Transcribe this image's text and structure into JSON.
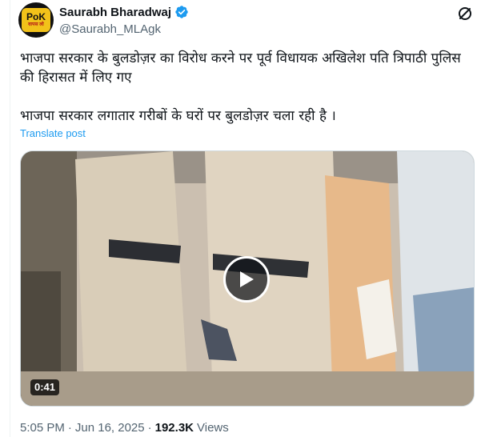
{
  "author": {
    "display_name": "Saurabh Bharadwaj",
    "handle": "@Saurabh_MLAgk",
    "verified": true,
    "avatar_text_main": "PoK",
    "avatar_text_sub": "वापस लो",
    "verified_color": "#1d9bf0"
  },
  "tweet": {
    "paragraph_1": "भाजपा सरकार के बुलडोज़र का विरोध करने पर पूर्व विधायक अखिलेश पति त्रिपाठी पुलिस की हिरासत में लिए गए",
    "paragraph_2": "भाजपा सरकार लगातार गरीबों के घरों पर बुलडोज़र चला रही है ।",
    "translate_label": "Translate post"
  },
  "media": {
    "type": "video",
    "duration": "0:41",
    "play_icon": "play-icon"
  },
  "meta": {
    "time": "5:05 PM",
    "separator": "·",
    "date": "Jun 16, 2025",
    "views_count": "192.3K",
    "views_label": "Views"
  },
  "icons": {
    "grok": "grok-icon",
    "verified": "verified-badge-icon"
  },
  "colors": {
    "link": "#1d9bf0",
    "muted": "#536471",
    "text": "#0f1419"
  }
}
